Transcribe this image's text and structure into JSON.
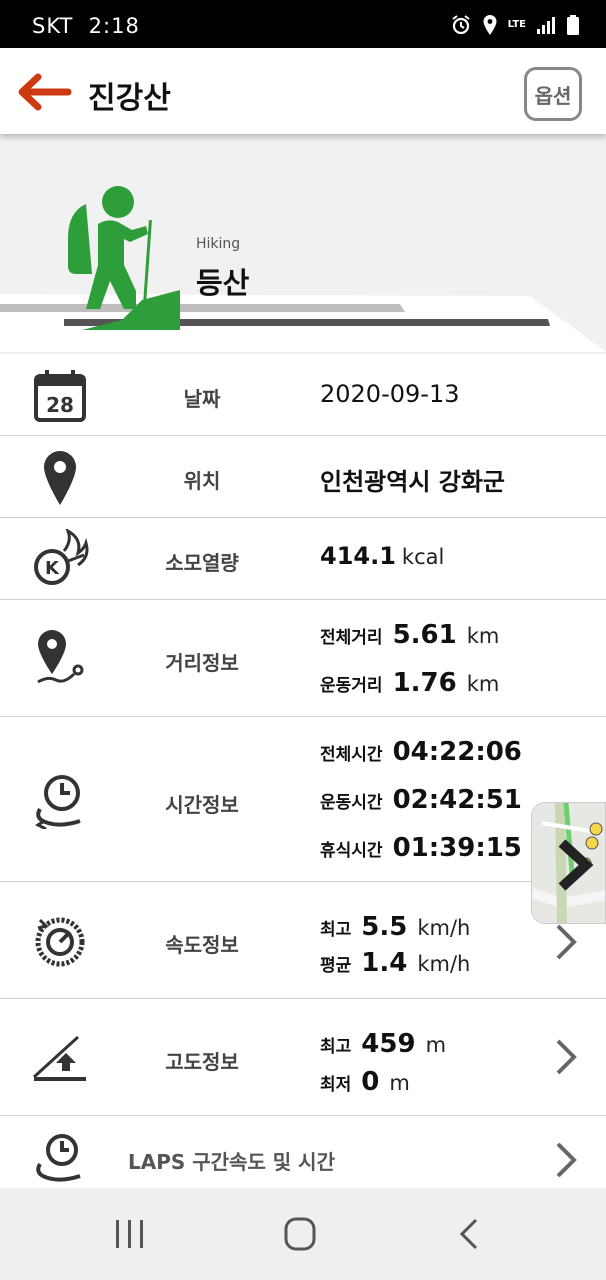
{
  "status": {
    "carrier": "SKT",
    "time": "2:18",
    "network": "LTE"
  },
  "header": {
    "title": "진강산",
    "options_label": "옵션"
  },
  "activity": {
    "type_en": "Hiking",
    "type_ko": "등산"
  },
  "date": {
    "label": "날짜",
    "value": "2020-09-13",
    "calendar_day": "28"
  },
  "location": {
    "label": "위치",
    "value": "인천광역시 강화군"
  },
  "calories": {
    "label": "소모열량",
    "value": "414.1",
    "unit": "kcal"
  },
  "distance": {
    "label": "거리정보",
    "total_label": "전체거리",
    "total_value": "5.61",
    "total_unit": "km",
    "moving_label": "운동거리",
    "moving_value": "1.76",
    "moving_unit": "km"
  },
  "time": {
    "label": "시간정보",
    "total_label": "전체시간",
    "total_value": "04:22:06",
    "moving_label": "운동시간",
    "moving_value": "02:42:51",
    "rest_label": "휴식시간",
    "rest_value": "01:39:15"
  },
  "speed": {
    "label": "속도정보",
    "max_label": "최고",
    "max_value": "5.5",
    "max_unit": "km/h",
    "avg_label": "평균",
    "avg_value": "1.4",
    "avg_unit": "km/h"
  },
  "altitude": {
    "label": "고도정보",
    "max_label": "최고",
    "max_value": "459",
    "max_unit": "m",
    "min_label": "최저",
    "min_value": "0",
    "min_unit": "m"
  },
  "laps": {
    "label": "LAPS 구간속도 및 시간"
  },
  "colors": {
    "accent_orange": "#cc3a12",
    "hiker_green": "#2e9e3a",
    "icon_dark": "#333333"
  },
  "icons": [
    "back-arrow-icon",
    "calendar-icon",
    "location-pin-icon",
    "calorie-fire-icon",
    "distance-route-icon",
    "time-clock-icon",
    "speed-gauge-icon",
    "altitude-icon",
    "laps-clock-icon",
    "chevron-right-icon"
  ]
}
